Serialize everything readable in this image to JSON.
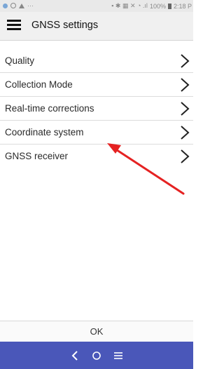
{
  "status_bar": {
    "right_text": "100%",
    "time": "2:18 P"
  },
  "app_bar": {
    "title": "GNSS settings"
  },
  "menu": {
    "items": [
      {
        "label": "Quality"
      },
      {
        "label": "Collection Mode"
      },
      {
        "label": "Real-time corrections"
      },
      {
        "label": "Coordinate system"
      },
      {
        "label": "GNSS receiver"
      }
    ]
  },
  "footer": {
    "ok_label": "OK"
  },
  "colors": {
    "nav_bar": "#4a57b9",
    "annotation_arrow": "#e52222"
  },
  "icons": [
    "menu-icon",
    "chevron-right-icon",
    "back-icon",
    "home-icon",
    "recents-icon"
  ]
}
